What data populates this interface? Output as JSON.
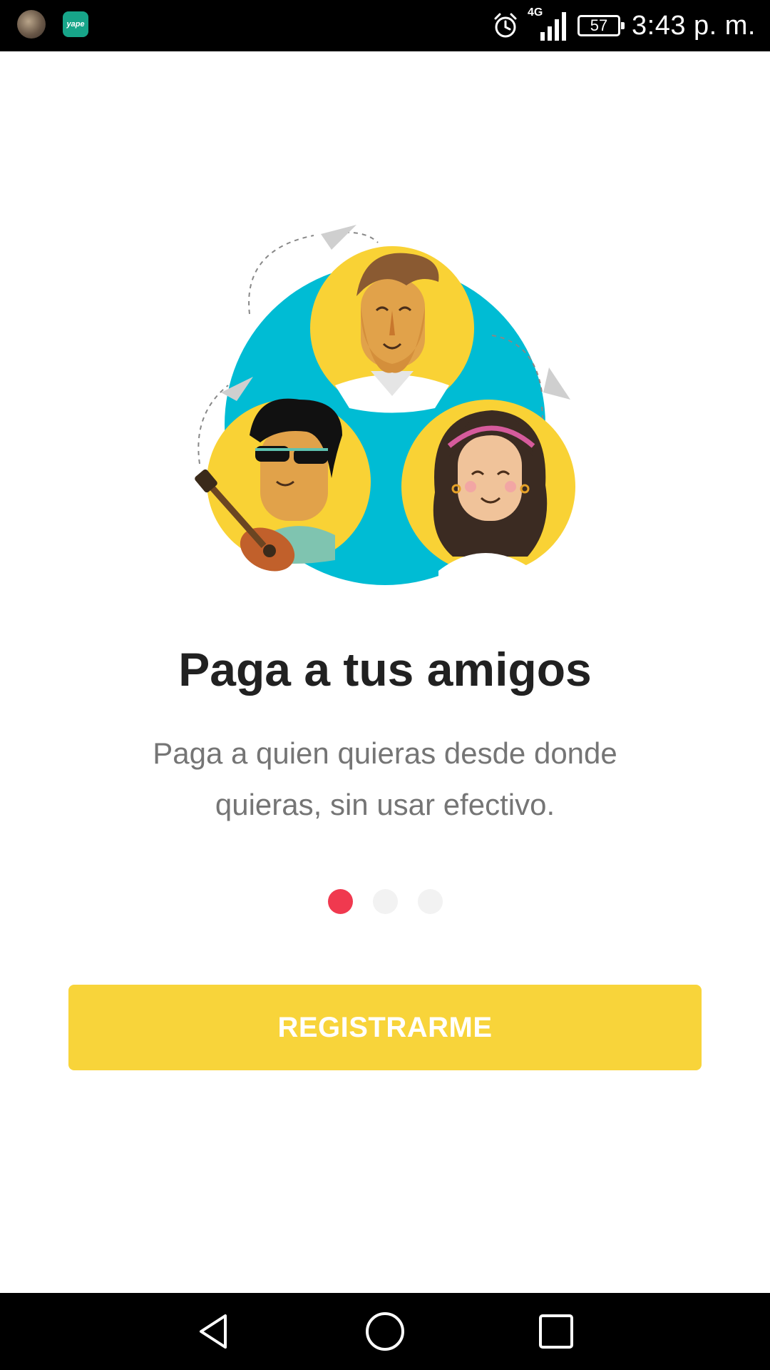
{
  "status_bar": {
    "time": "3:43 p. m.",
    "battery": "57",
    "network": "4G",
    "notification_icons": [
      "avatar-notification-icon",
      "yape-app-icon"
    ],
    "yape_icon_text": "yape"
  },
  "onboarding": {
    "title": "Paga a tus amigos",
    "subtitle": "Paga a quien quieras desde donde quieras, sin usar efectivo.",
    "pages_total": 3,
    "current_page": 1
  },
  "actions": {
    "register_label": "REGISTRARME"
  },
  "colors": {
    "accent_yellow": "#f8d43a",
    "illustration_teal": "#00bcd4",
    "dot_active": "#f0394f",
    "dot_inactive": "#f2f2f2",
    "title_text": "#212121",
    "subtitle_text": "#757575"
  },
  "nav_bar": {
    "icons": [
      "back-icon",
      "home-icon",
      "recents-icon"
    ]
  }
}
